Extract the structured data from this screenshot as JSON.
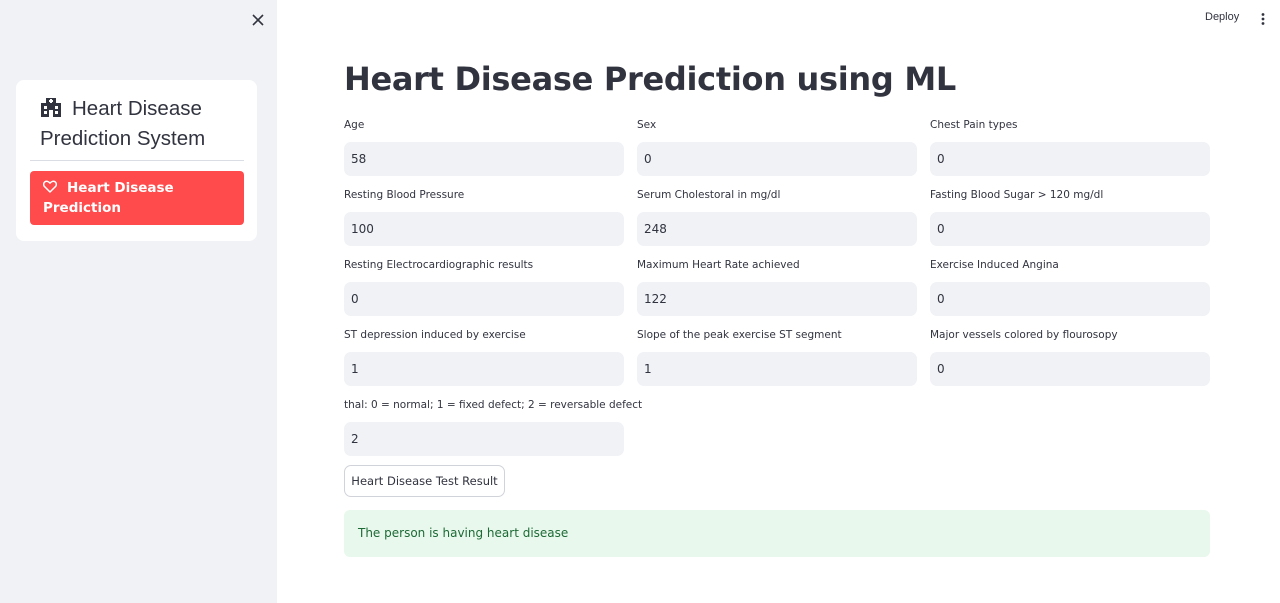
{
  "sidebar": {
    "title": "Heart Disease Prediction System",
    "menu_items": [
      {
        "label": "Heart Disease Prediction",
        "active": true
      }
    ]
  },
  "header": {
    "deploy_label": "Deploy"
  },
  "main": {
    "title": "Heart Disease Prediction using ML",
    "fields": [
      {
        "label": "Age",
        "value": "58"
      },
      {
        "label": "Sex",
        "value": "0"
      },
      {
        "label": "Chest Pain types",
        "value": "0"
      },
      {
        "label": "Resting Blood Pressure",
        "value": "100"
      },
      {
        "label": "Serum Cholestoral in mg/dl",
        "value": "248"
      },
      {
        "label": "Fasting Blood Sugar > 120 mg/dl",
        "value": "0"
      },
      {
        "label": "Resting Electrocardiographic results",
        "value": "0"
      },
      {
        "label": "Maximum Heart Rate achieved",
        "value": "122"
      },
      {
        "label": "Exercise Induced Angina",
        "value": "0"
      },
      {
        "label": "ST depression induced by exercise",
        "value": "1"
      },
      {
        "label": "Slope of the peak exercise ST segment",
        "value": "1"
      },
      {
        "label": "Major vessels colored by flourosopy",
        "value": "0"
      },
      {
        "label": "thal: 0 = normal; 1 = fixed defect; 2 = reversable defect",
        "value": "2"
      }
    ],
    "submit_label": "Heart Disease Test Result",
    "result_text": "The person is having heart disease"
  },
  "colors": {
    "sidebar_bg": "#f0f2f6",
    "accent": "#ff4b4b",
    "input_bg": "#f0f2f6",
    "success_bg": "#e8f8ec",
    "success_text": "#1d6a36"
  },
  "icons": [
    "close-icon",
    "hospital-icon",
    "heart-icon",
    "kebab-menu-icon"
  ]
}
